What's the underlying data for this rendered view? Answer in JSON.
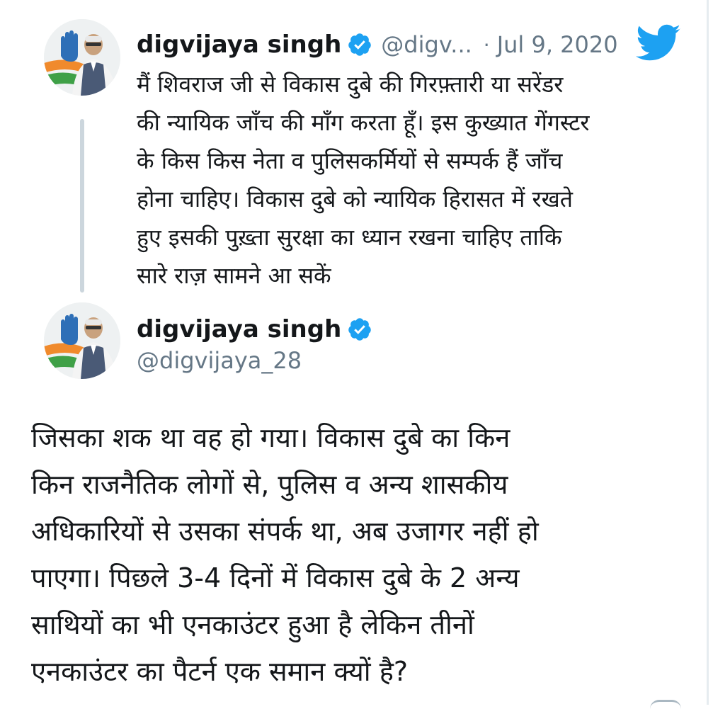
{
  "parent_tweet": {
    "author_name": "digvijaya singh",
    "handle": "@digv...",
    "separator": "·",
    "date": "Jul 9, 2020",
    "verified_icon": "verified-badge-icon",
    "brand_icon": "twitter-bird-icon",
    "text_lines": [
      "मैं शिवराज जी से विकास दुबे की गिरफ़्तारी या सरेंडर",
      "की न्यायिक जॉंच की मॉंग करता हूँ। इस कुख्यात गेंगस्टर",
      "के किस किस नेता व पुलिसकर्मियों से सम्पर्क हैं जॉंच",
      "होना चाहिए। विकास दुबे को न्यायिक हिरासत में रखते",
      "हुए इसकी पुख़्ता सुरक्षा का ध्यान रखना चाहिए ताकि",
      "सारे राज़ सामने आ सकें"
    ]
  },
  "main_tweet": {
    "author_name": "digvijaya singh",
    "handle": "@digvijaya_28",
    "verified_icon": "verified-badge-icon",
    "text_lines": [
      "जिसका शक था वह हो गया। विकास दुबे का किन",
      "किन राजनैतिक लोगों से, पुलिस व अन्य शासकीय",
      "अधिकारियों से उसका संपर्क था, अब उजागर नहीं हो",
      "पाएगा। पिछले 3-4 दिनों में विकास दुबे के 2 अन्य",
      "साथियों का भी एनकाउंटर हुआ है लेकिन तीनों",
      "एनकाउंटर का पैटर्न एक समान क्यों है?"
    ]
  },
  "colors": {
    "text_primary": "#14171a",
    "text_secondary": "#657786",
    "twitter_blue": "#1da1f2",
    "thread_line": "#ccd6dd"
  }
}
